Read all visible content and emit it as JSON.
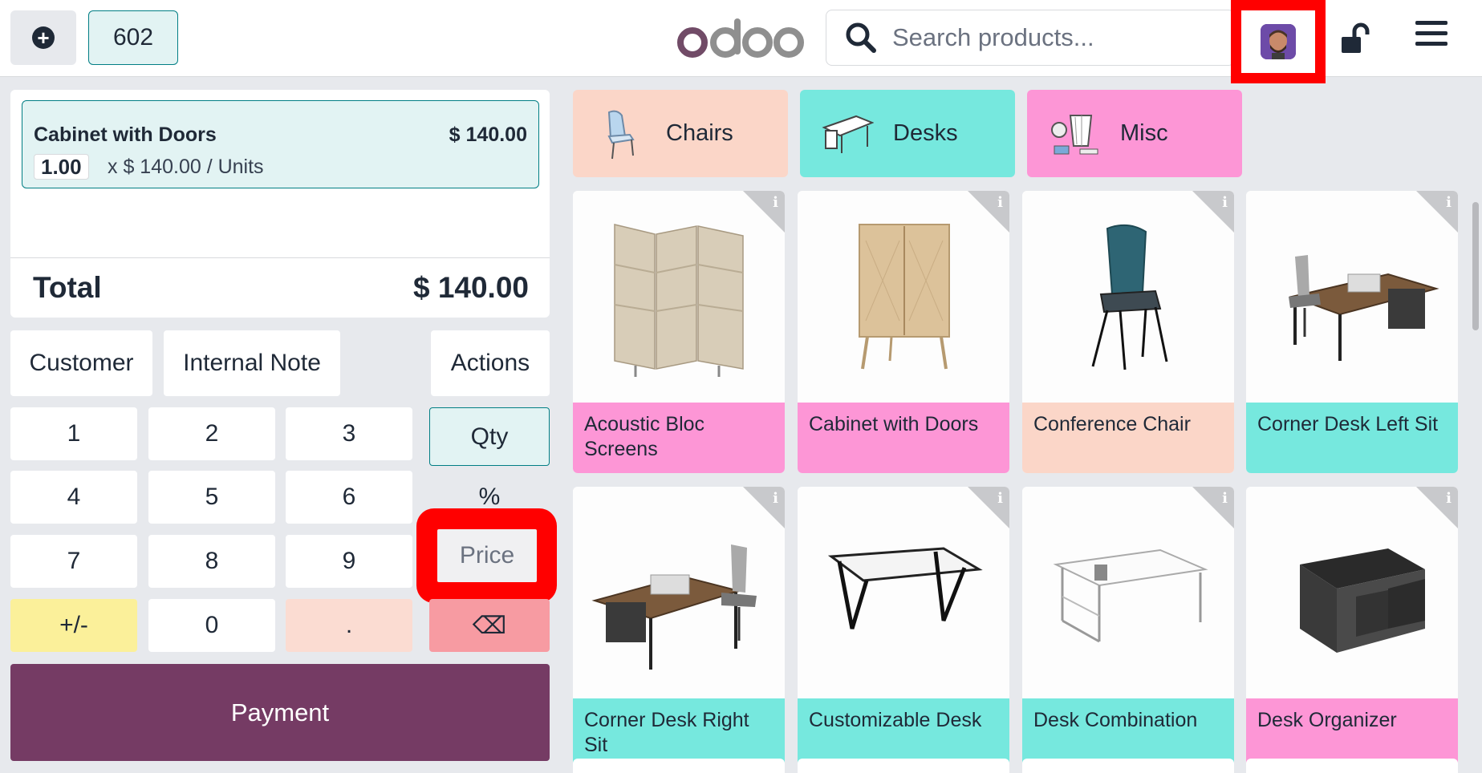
{
  "topbar": {
    "add_icon": "plus-circle-icon",
    "order_number": "602",
    "logo_text": "odoo",
    "search_placeholder": "Search products...",
    "search_icon": "search-icon",
    "lock_icon": "unlock-icon",
    "menu_icon": "hamburger-menu-icon"
  },
  "order": {
    "line": {
      "name": "Cabinet with Doors",
      "price": "$ 140.00",
      "qty": "1.00",
      "unit_text": "x $ 140.00 / Units"
    },
    "total_label": "Total",
    "total_value": "$ 140.00"
  },
  "controls": {
    "customer": "Customer",
    "internal_note": "Internal Note",
    "actions": "Actions"
  },
  "numpad": {
    "k1": "1",
    "k2": "2",
    "k3": "3",
    "k4": "4",
    "k5": "5",
    "k6": "6",
    "k7": "7",
    "k8": "8",
    "k9": "9",
    "plusminus": "+/-",
    "k0": "0",
    "dot": ".",
    "qty": "Qty",
    "percent": "%",
    "price": "Price",
    "backspace": "⌫"
  },
  "payment_label": "Payment",
  "categories": [
    {
      "label": "Chairs",
      "color": "#fbd6c8"
    },
    {
      "label": "Desks",
      "color": "#76e8de"
    },
    {
      "label": "Misc",
      "color": "#fd96d6"
    }
  ],
  "products": [
    {
      "name": "Acoustic Bloc Screens",
      "color": "#fd96d6"
    },
    {
      "name": "Cabinet with Doors",
      "color": "#fd96d6"
    },
    {
      "name": "Conference Chair",
      "color": "#fbd6c8"
    },
    {
      "name": "Corner Desk Left Sit",
      "color": "#76e8de"
    },
    {
      "name": "Corner Desk Right Sit",
      "color": "#76e8de"
    },
    {
      "name": "Customizable Desk",
      "color": "#76e8de"
    },
    {
      "name": "Desk Combination",
      "color": "#76e8de"
    },
    {
      "name": "Desk Organizer",
      "color": "#fd96d6"
    }
  ],
  "info_label": "i"
}
